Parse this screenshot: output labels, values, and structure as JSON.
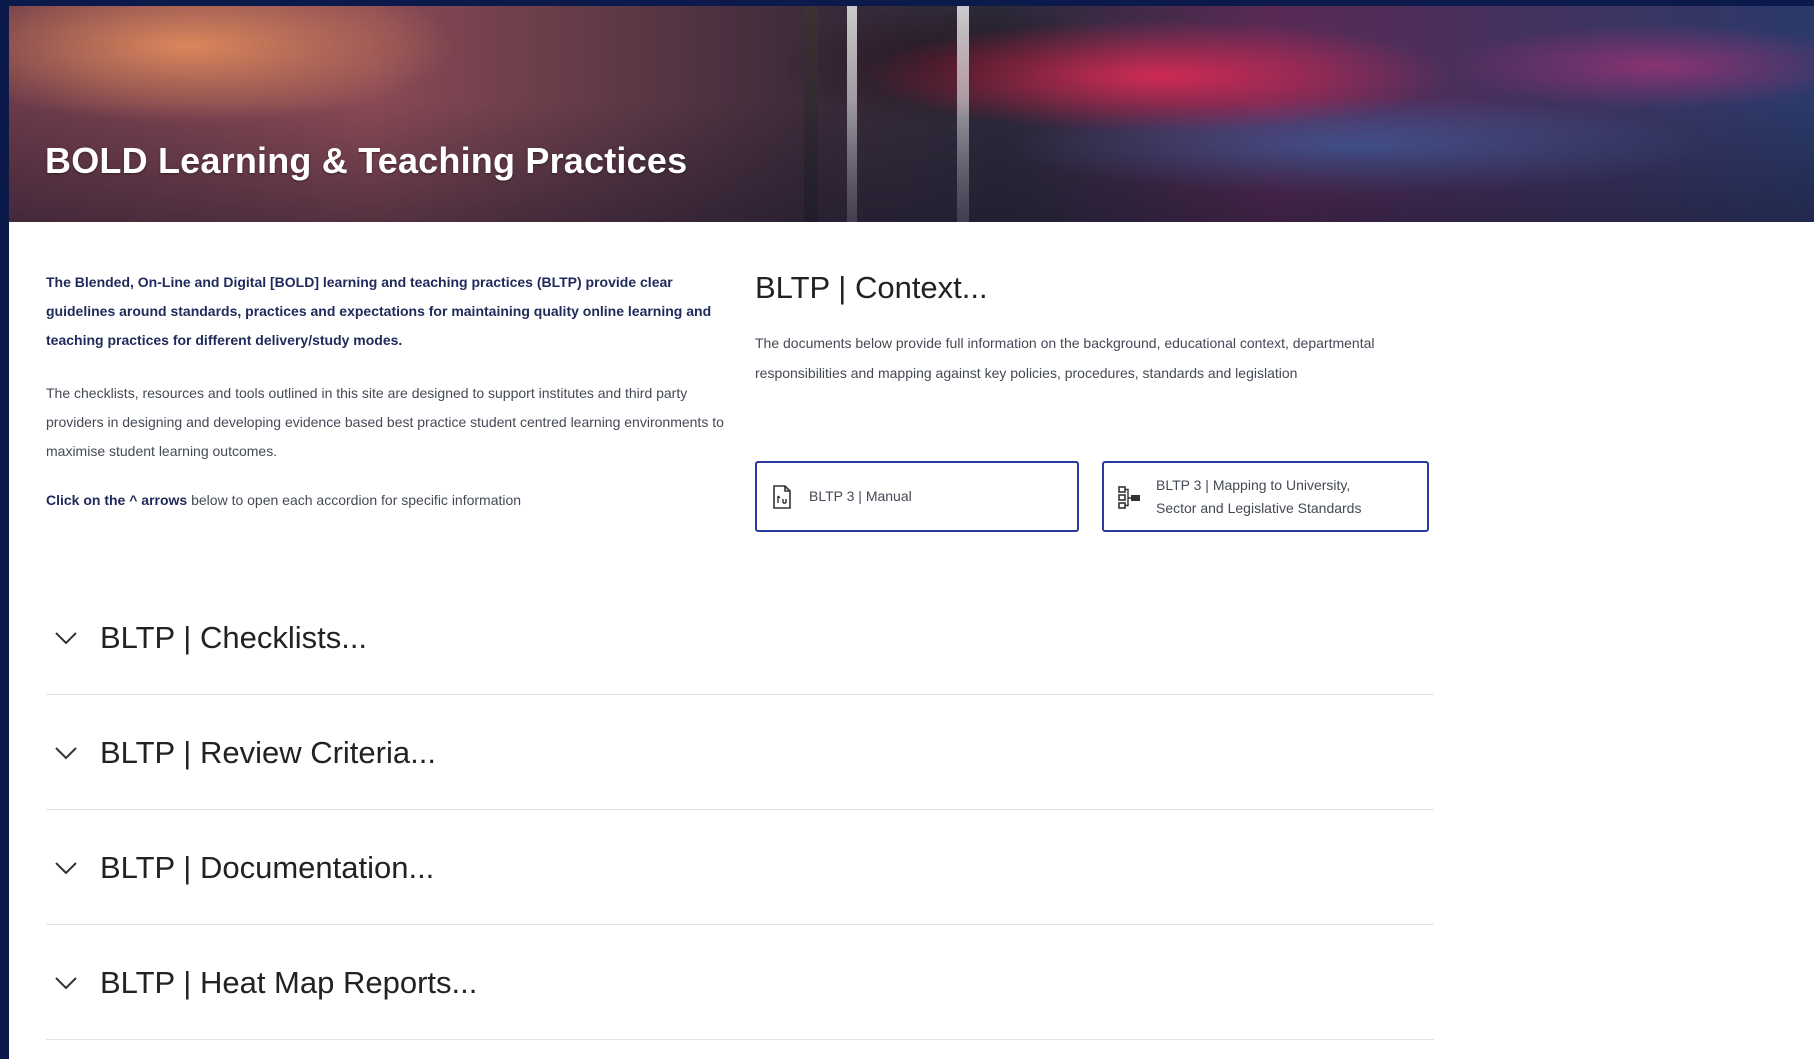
{
  "hero": {
    "title": "BOLD Learning & Teaching Practices"
  },
  "intro": {
    "bold_paragraph": "The Blended, On-Line and Digital [BOLD] learning and teaching practices (BLTP) provide clear guidelines around standards, practices and expectations for maintaining quality online learning and teaching practices for different delivery/study modes.",
    "paragraph": "The checklists, resources and tools outlined in this site are designed to support institutes and third party providers in designing and developing evidence based best practice student centred learning environments to maximise student learning outcomes.",
    "click_prefix": "Click on the ^ arrows",
    "click_suffix": " below to open each accordion for specific information"
  },
  "context": {
    "heading": "BLTP | Context...",
    "description": "The documents below provide full information on the background, educational context, departmental responsibilities and mapping against key policies, procedures, standards and legislation",
    "buttons": [
      {
        "label": "BLTP 3 | Manual",
        "icon": "document-icon"
      },
      {
        "label_line1": "BLTP 3 | Mapping to University,",
        "label_line2": "Sector and Legislative Standards",
        "icon": "hierarchy-icon"
      }
    ]
  },
  "accordions": [
    {
      "label": "BLTP | Checklists..."
    },
    {
      "label": "BLTP | Review Criteria..."
    },
    {
      "label": "BLTP | Documentation..."
    },
    {
      "label": "BLTP | Heat Map Reports..."
    }
  ],
  "colors": {
    "accent_border": "#2b3aa0",
    "page_frame": "#0b1a4a",
    "heading_text": "#1f2a5a"
  }
}
